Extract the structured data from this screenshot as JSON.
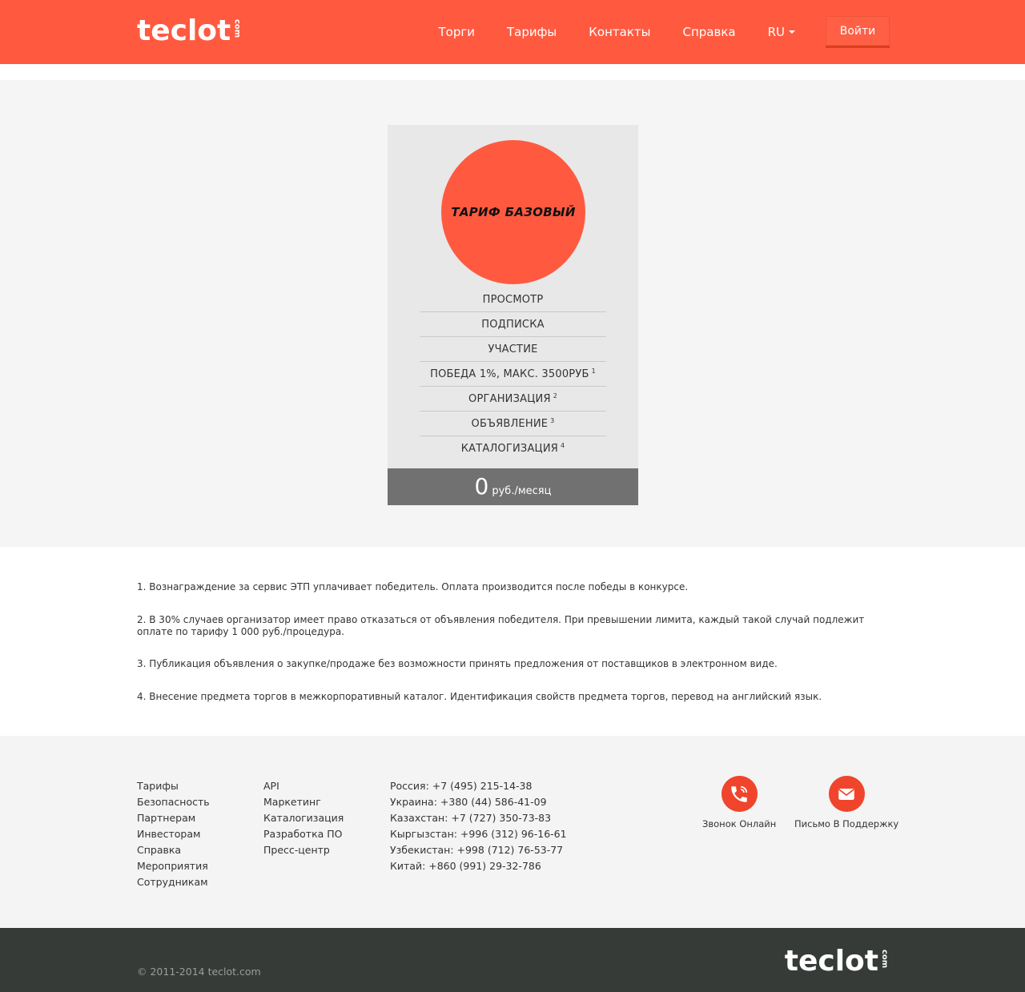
{
  "header": {
    "logo": "teclot",
    "logo_suffix": "com",
    "nav": [
      "Торги",
      "Тарифы",
      "Контакты",
      "Справка"
    ],
    "lang": "RU",
    "login_label": "Войти",
    "brand_color": "#ff5a40"
  },
  "plan": {
    "title": "ТАРИФ БАЗОВЫЙ",
    "features": [
      {
        "label": "ПРОСМОТР",
        "note": ""
      },
      {
        "label": "ПОДПИСКА",
        "note": ""
      },
      {
        "label": "УЧАСТИЕ",
        "note": ""
      },
      {
        "label": "ПОБЕДА 1%, МАКС. 3500РУБ",
        "note": "1"
      },
      {
        "label": "ОРГАНИЗАЦИЯ",
        "note": "2"
      },
      {
        "label": "ОБЪЯВЛЕНИЕ",
        "note": "3"
      },
      {
        "label": "КАТАЛОГИЗАЦИЯ",
        "note": "4"
      }
    ],
    "price": "0",
    "price_unit": "руб./месяц"
  },
  "notes": [
    "1.  Вознаграждение за сервис ЭТП уплачивает победитель. Оплата производится после победы в конкурсе.",
    "2.  В 30% случаев организатор имеет право отказаться от объявления победителя. При превышении лимита, каждый такой случай подлежит оплате по тарифу 1 000 руб./процедура.",
    "3.  Публикация объявления о закупке/продаже без возможности принять предложения от поставщиков в электронном виде.",
    "4.  Внесение предмета торгов в межкорпоративный каталог. Идентификация свойств предмета торгов, перевод на английский язык."
  ],
  "footer": {
    "col1": [
      "Тарифы",
      "Безопасность",
      "Партнерам",
      "Инвесторам",
      "Справка",
      "Мероприятия",
      "Сотрудникам"
    ],
    "col2": [
      "API",
      "Маркетинг",
      "Каталогизация",
      "Разработка ПО",
      "Пресс-центр"
    ],
    "contacts": [
      "Россия: +7 (495) 215-14-38",
      "Украина: +380 (44) 586-41-09",
      "Казахстан: +7 (727) 350-73-83",
      "Кыргызстан: +996 (312) 96-16-61",
      "Узбекистан: +998 (712) 76-53-77",
      "Китай: +860 (991) 29-32-786"
    ],
    "call_label": "Звонок Онлайн",
    "call_icon": "phone-icon",
    "mail_label": "Письмо В Поддержку",
    "mail_icon": "envelope-icon"
  },
  "bottom": {
    "copyright": "© 2011-2014 teclot.com",
    "logo": "teclot",
    "logo_suffix": "com"
  }
}
